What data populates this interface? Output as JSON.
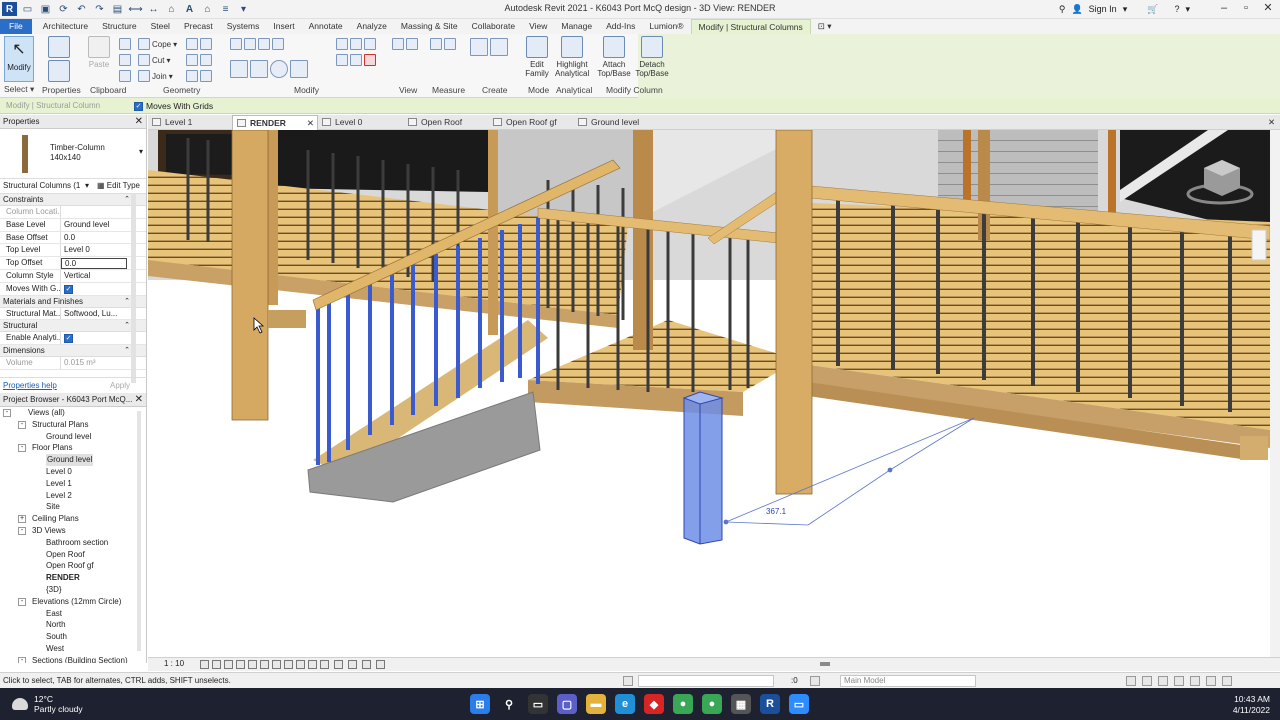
{
  "app": {
    "title": "Autodesk Revit 2021 - K6043 Port McQ design - 3D View: RENDER",
    "sign_in": "Sign In"
  },
  "ribbon_tabs": [
    "File",
    "Architecture",
    "Structure",
    "Steel",
    "Precast",
    "Systems",
    "Insert",
    "Annotate",
    "Analyze",
    "Massing & Site",
    "Collaborate",
    "View",
    "Manage",
    "Add-Ins",
    "Lumion®",
    "Modify | Structural Columns"
  ],
  "ribbon": {
    "modify_label": "Modify",
    "paste_label": "Paste",
    "cope": "Cope",
    "cut": "Cut",
    "join": "Join",
    "edit_family": [
      "Edit",
      "Family"
    ],
    "highlight_analytical": [
      "Highlight",
      "Analytical"
    ],
    "attach": [
      "Attach",
      "Top/Base"
    ],
    "detach": [
      "Detach",
      "Top/Base"
    ],
    "panels": [
      "Select",
      "Properties",
      "Clipboard",
      "Geometry",
      "Modify",
      "View",
      "Measure",
      "Create",
      "Mode",
      "Analytical",
      "Modify Column"
    ]
  },
  "options_bar": {
    "context": "Modify | Structural Column",
    "moves_with_grids": "Moves With Grids"
  },
  "properties": {
    "header": "Properties",
    "type_name": "Timber-Column",
    "type_size": "140x140",
    "instance_filter": "Structural Columns (1",
    "edit_type": "Edit Type",
    "groups": {
      "constraints": "Constraints",
      "materials": "Materials and Finishes",
      "structural": "Structural",
      "dimensions": "Dimensions"
    },
    "rows": {
      "column_location": {
        "k": "Column Locati...",
        "v": ""
      },
      "base_level": {
        "k": "Base Level",
        "v": "Ground level"
      },
      "base_offset": {
        "k": "Base Offset",
        "v": "0.0"
      },
      "top_level": {
        "k": "Top Level",
        "v": "Level 0"
      },
      "top_offset": {
        "k": "Top Offset",
        "v": "0.0"
      },
      "column_style": {
        "k": "Column Style",
        "v": "Vertical"
      },
      "moves_with_grids": {
        "k": "Moves With G...",
        "v": ""
      },
      "structural_material": {
        "k": "Structural Mat...",
        "v": "Softwood, Lu..."
      },
      "enable_analytical": {
        "k": "Enable Analyti...",
        "v": ""
      },
      "volume": {
        "k": "Volume",
        "v": "0.015 m³"
      }
    },
    "help": "Properties help",
    "apply": "Apply"
  },
  "project_browser": {
    "header": "Project Browser - K6043 Port McQ...",
    "nodes": [
      {
        "label": "Views (all)",
        "level": 0,
        "toggle": "-"
      },
      {
        "label": "Structural Plans",
        "level": 1,
        "toggle": "-"
      },
      {
        "label": "Ground level",
        "level": 2,
        "toggle": ""
      },
      {
        "label": "Floor Plans",
        "level": 1,
        "toggle": "-"
      },
      {
        "label": "Ground level",
        "level": 2,
        "toggle": "",
        "selected": true
      },
      {
        "label": "Level 0",
        "level": 2,
        "toggle": ""
      },
      {
        "label": "Level 1",
        "level": 2,
        "toggle": ""
      },
      {
        "label": "Level 2",
        "level": 2,
        "toggle": ""
      },
      {
        "label": "Site",
        "level": 2,
        "toggle": ""
      },
      {
        "label": "Ceiling Plans",
        "level": 1,
        "toggle": "+"
      },
      {
        "label": "3D Views",
        "level": 1,
        "toggle": "-"
      },
      {
        "label": "Bathroom section",
        "level": 2,
        "toggle": ""
      },
      {
        "label": "Open Roof",
        "level": 2,
        "toggle": ""
      },
      {
        "label": "Open Roof gf",
        "level": 2,
        "toggle": ""
      },
      {
        "label": "RENDER",
        "level": 2,
        "toggle": "",
        "bold": true
      },
      {
        "label": "{3D}",
        "level": 2,
        "toggle": ""
      },
      {
        "label": "Elevations (12mm Circle)",
        "level": 1,
        "toggle": "-"
      },
      {
        "label": "East",
        "level": 2,
        "toggle": ""
      },
      {
        "label": "North",
        "level": 2,
        "toggle": ""
      },
      {
        "label": "South",
        "level": 2,
        "toggle": ""
      },
      {
        "label": "West",
        "level": 2,
        "toggle": ""
      },
      {
        "label": "Sections (Building Section)",
        "level": 1,
        "toggle": "-"
      }
    ]
  },
  "view_tabs": [
    {
      "label": "Level 1",
      "active": false
    },
    {
      "label": "RENDER",
      "active": true
    },
    {
      "label": "Level 0",
      "active": false
    },
    {
      "label": "Open Roof",
      "active": false
    },
    {
      "label": "Open Roof gf",
      "active": false
    },
    {
      "label": "Ground level",
      "active": false
    }
  ],
  "viewport": {
    "dimension_label": "367.1"
  },
  "view_control": {
    "scale": "1 : 10"
  },
  "status_bar": {
    "message": "Click to select, TAB for alternates, CTRL adds, SHIFT unselects.",
    "zero": ":0",
    "model": "Main Model"
  },
  "taskbar": {
    "temperature": "12°C",
    "weather": "Partly cloudy",
    "time": "10:43 AM",
    "date": "4/11/2022"
  },
  "colors": {
    "file_tab": "#2a6ec8",
    "context_tint": "#e6f2d2",
    "wood": "#e5c27c",
    "selection": "#3a5bd0"
  }
}
